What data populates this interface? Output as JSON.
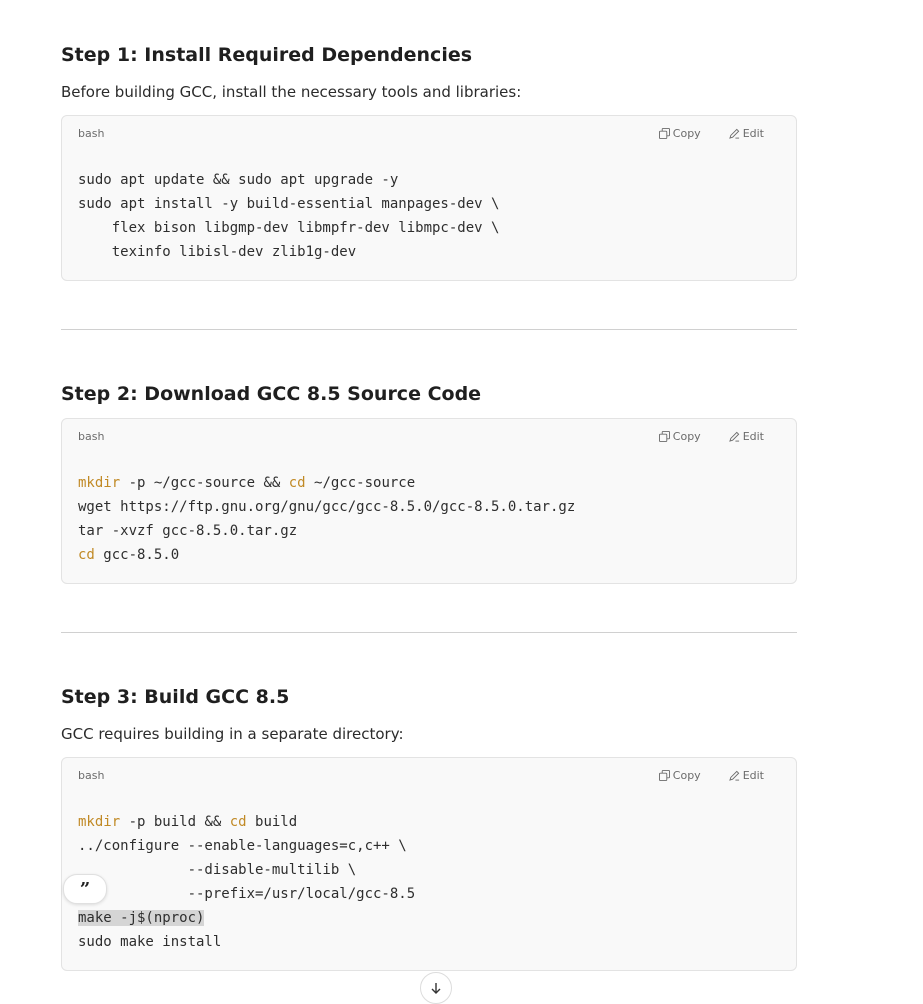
{
  "steps": [
    {
      "title": "Step 1: Install Required Dependencies",
      "intro": "Before building GCC, install the necessary tools and libraries:",
      "code": {
        "language": "bash",
        "copy_label": "Copy",
        "edit_label": "Edit",
        "lines": [
          "sudo apt update && sudo apt upgrade -y",
          "sudo apt install -y build-essential manpages-dev \\",
          "    flex bison libgmp-dev libmpfr-dev libmpc-dev \\",
          "    texinfo libisl-dev zlib1g-dev"
        ]
      }
    },
    {
      "title": "Step 2: Download GCC 8.5 Source Code",
      "code": {
        "language": "bash",
        "copy_label": "Copy",
        "edit_label": "Edit",
        "l1_kw": "mkdir",
        "l1_mid": " -p ~/gcc-source && ",
        "l1_kw2": "cd",
        "l1_end": " ~/gcc-source",
        "l2": "wget https://ftp.gnu.org/gnu/gcc/gcc-8.5.0/gcc-8.5.0.tar.gz",
        "l3": "tar -xvzf gcc-8.5.0.tar.gz",
        "l4_kw": "cd",
        "l4_end": " gcc-8.5.0"
      }
    },
    {
      "title": "Step 3: Build GCC 8.5",
      "intro": "GCC requires building in a separate directory:",
      "code": {
        "language": "bash",
        "copy_label": "Copy",
        "edit_label": "Edit",
        "l1_kw": "mkdir",
        "l1_mid": " -p build && ",
        "l1_kw2": "cd",
        "l1_end": " build",
        "l2": "../configure --enable-languages=c,c++ \\",
        "l3": "             --disable-multilib \\",
        "l4": "             --prefix=/usr/local/gcc-8.5",
        "l5": "make -j$(nproc)",
        "l6": "sudo make install"
      }
    }
  ],
  "quote_glyph": "”",
  "colors": {
    "keyword": "#c18a26",
    "code_bg": "#f9f9f9",
    "selection": "#d5d5d5"
  },
  "icons": [
    "copy-icon",
    "edit-icon",
    "quote-icon",
    "arrow-down-icon"
  ]
}
